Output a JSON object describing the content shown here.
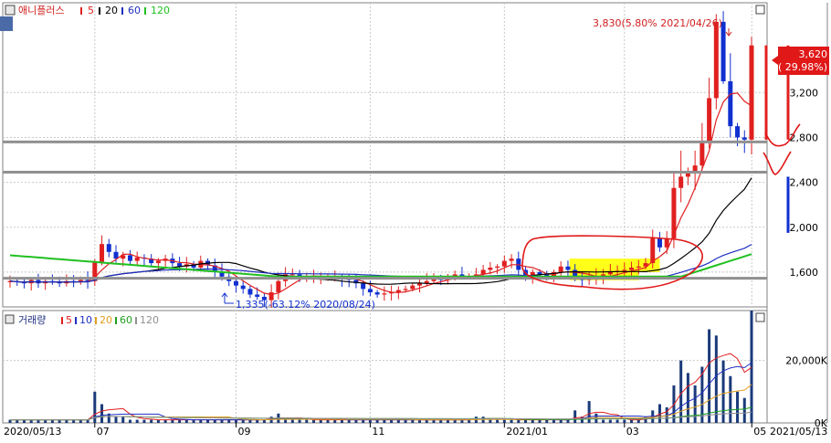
{
  "price_panel": {
    "title": "애니플러스",
    "ma_legend": [
      {
        "label": "5",
        "color": "#e02020"
      },
      {
        "label": "20",
        "color": "#000000"
      },
      {
        "label": "60",
        "color": "#2030c0"
      },
      {
        "label": "120",
        "color": "#20c020"
      }
    ],
    "max_annotation": "3,830(5.80% 2021/04/26)",
    "min_annotation": "1,335(-63.12% 2020/08/24)",
    "current_price": "3,620",
    "current_change": "( 29.98%)"
  },
  "volume_panel": {
    "title": "거래량",
    "ma_legend": [
      {
        "label": "5",
        "color": "#e02020"
      },
      {
        "label": "10",
        "color": "#2030c0"
      },
      {
        "label": "20",
        "color": "#e0a020"
      },
      {
        "label": "60",
        "color": "#20a020"
      },
      {
        "label": "120",
        "color": "#909090"
      }
    ]
  },
  "x_axis": {
    "start_label": "2020/05/13",
    "end_label": "2021/05/13",
    "ticks": [
      "07",
      "09",
      "11",
      "2021/01",
      "03",
      "05"
    ]
  },
  "colors": {
    "up": "#e02020",
    "down": "#1030d0",
    "highlight": "#ffff00",
    "support_line": "#909090"
  },
  "chart_data": [
    {
      "type": "candlestick",
      "title": "애니플러스",
      "y_ticks": [
        1600,
        2000,
        2400,
        2800,
        3200
      ],
      "y_tick_labels": [
        "1,600",
        "2,000",
        "2,400",
        "2,800",
        "3,200"
      ],
      "ylim": [
        1290,
        4000
      ],
      "x_tick_labels": [
        "2020/05/13",
        "07",
        "09",
        "11",
        "2021/01",
        "03",
        "05",
        "2021/05/13"
      ],
      "close": [
        1520,
        1510,
        1500,
        1530,
        1500,
        1520,
        1510,
        1500,
        1520,
        1510,
        1530,
        1520,
        1690,
        1850,
        1780,
        1720,
        1750,
        1700,
        1730,
        1720,
        1680,
        1700,
        1720,
        1680,
        1650,
        1670,
        1640,
        1700,
        1660,
        1600,
        1560,
        1520,
        1480,
        1450,
        1400,
        1380,
        1350,
        1420,
        1520,
        1580,
        1580,
        1550,
        1560,
        1560,
        1560,
        1560,
        1560,
        1540,
        1530,
        1500,
        1450,
        1420,
        1400,
        1410,
        1420,
        1440,
        1450,
        1480,
        1500,
        1520,
        1540,
        1530,
        1560,
        1580,
        1560,
        1560,
        1580,
        1620,
        1640,
        1650,
        1700,
        1720,
        1620,
        1560,
        1600,
        1580,
        1560,
        1600,
        1650,
        1620,
        1560,
        1530,
        1540,
        1560,
        1580,
        1600,
        1610,
        1620,
        1640,
        1650,
        1680,
        1900,
        1820,
        1900,
        2350,
        2450,
        2500,
        2550,
        2750,
        3150,
        3830,
        3300,
        2900,
        2800,
        2780,
        3620
      ],
      "volume_k": [
        1,
        1,
        1,
        1,
        1,
        1,
        1,
        1,
        1,
        1,
        1,
        1,
        10,
        6,
        3,
        2,
        2,
        1,
        1,
        1,
        1,
        1,
        1,
        1,
        1,
        1,
        1,
        1,
        1,
        1,
        1,
        1,
        1,
        1,
        1,
        1,
        1,
        2,
        3,
        1,
        1,
        1,
        1,
        1,
        1,
        1,
        1,
        1,
        1,
        1,
        1,
        1,
        1,
        1,
        1,
        1,
        1,
        1,
        1,
        1,
        1,
        1,
        1,
        1,
        1,
        1,
        2,
        2,
        1,
        1,
        1,
        1,
        1,
        1,
        1,
        1,
        1,
        1,
        1,
        1,
        4,
        2,
        7,
        3,
        1,
        1,
        1,
        1,
        1,
        1,
        2,
        4,
        6,
        5,
        12,
        20,
        16,
        12,
        18,
        30,
        28,
        20,
        15,
        10,
        8,
        36
      ],
      "overlays": {
        "horizontal_support": [
          2760,
          2490,
          1545
        ]
      }
    },
    {
      "type": "bar",
      "title": "거래량",
      "y_ticks": [
        0,
        20000
      ],
      "y_tick_labels": [
        "0K",
        "20,000K"
      ],
      "ylim": [
        0,
        36000
      ]
    }
  ]
}
